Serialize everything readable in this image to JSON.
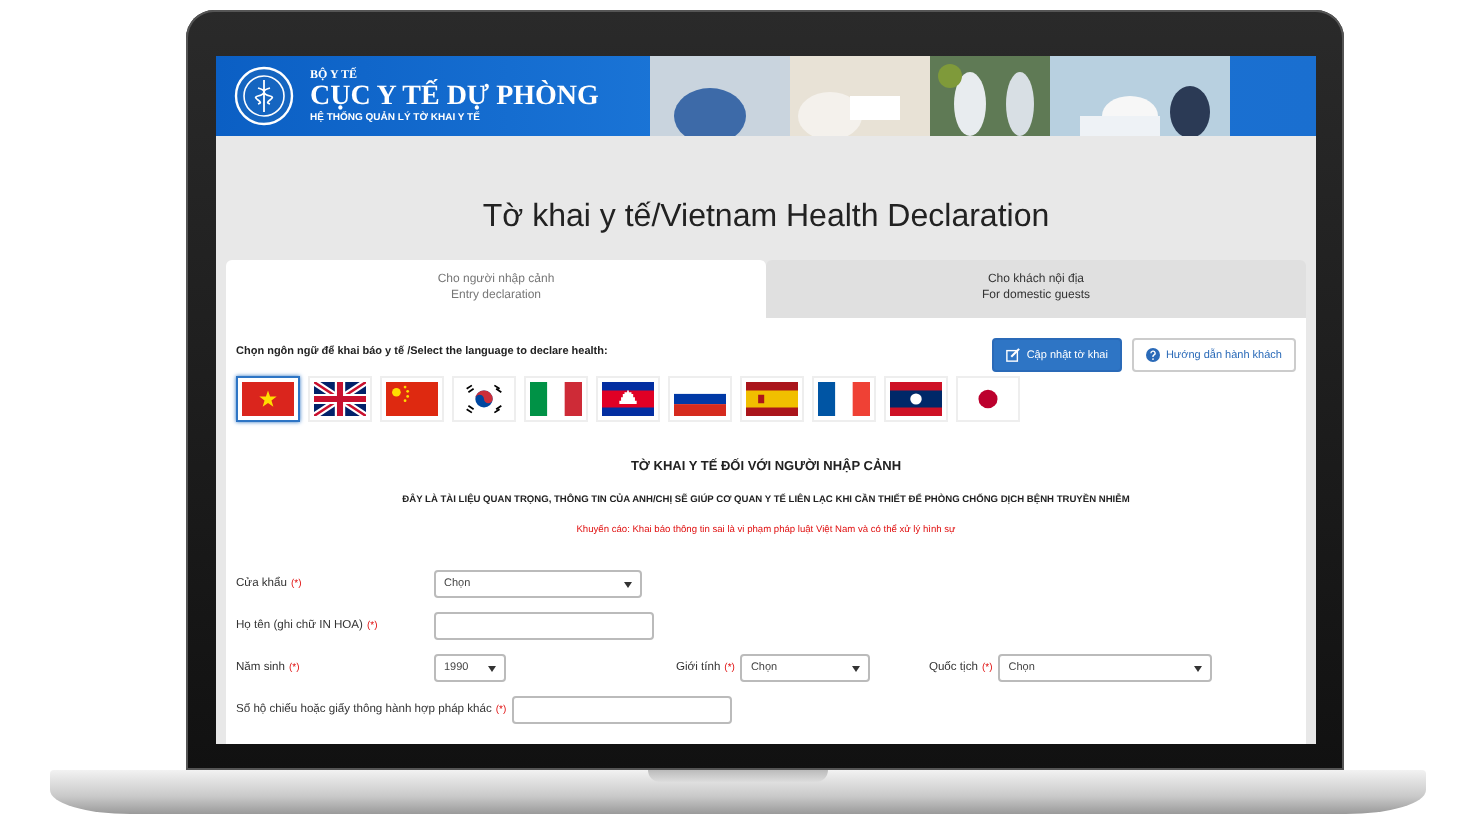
{
  "banner": {
    "ministry": "BỘ Y TẾ",
    "agency": "CỤC Y TẾ DỰ PHÒNG",
    "system": "HỆ THỐNG QUẢN LÝ TỜ KHAI Y TẾ"
  },
  "page_title": "Tờ khai y tế/Vietnam Health Declaration",
  "tabs": [
    {
      "label": "Cho người nhập cảnh",
      "sublabel": "Entry declaration",
      "selected": true
    },
    {
      "label": "Cho khách nội địa",
      "sublabel": "For domestic guests",
      "selected": false
    }
  ],
  "language_prompt": "Chọn ngôn ngữ để khai báo y tế /Select the language to declare health:",
  "buttons": [
    {
      "label": "Cập nhật tờ khai",
      "kind": "primary"
    },
    {
      "label": "Hướng dẫn hành khách",
      "kind": "help"
    }
  ],
  "languages": [
    {
      "kind": "vietnam",
      "selected": true
    },
    {
      "kind": "uk",
      "selected": false
    },
    {
      "kind": "china",
      "selected": false
    },
    {
      "kind": "korea",
      "selected": false
    },
    {
      "kind": "italy",
      "selected": false
    },
    {
      "kind": "cambodia",
      "selected": false
    },
    {
      "kind": "russia",
      "selected": false
    },
    {
      "kind": "spain",
      "selected": false
    },
    {
      "kind": "france",
      "selected": false
    },
    {
      "kind": "laos",
      "selected": false
    },
    {
      "kind": "japan",
      "selected": false
    }
  ],
  "form_title": "TỜ KHAI Y TẾ ĐỐI VỚI NGƯỜI NHẬP CẢNH",
  "notice": "ĐÂY LÀ TÀI LIỆU QUAN TRỌNG, THÔNG TIN CỦA ANH/CHỊ SẼ GIÚP CƠ QUAN Y TẾ LIÊN LẠC KHI CẦN THIẾT ĐỂ PHÒNG CHỐNG DỊCH BỆNH TRUYỀN NHIỄM",
  "warning": "Khuyến cáo: Khai báo thông tin sai là vi phạm pháp luật Việt Nam và có thể xử lý hình sự",
  "form_rows": [
    [
      {
        "label": "Cửa khẩu",
        "required": "(*)",
        "kind": "select",
        "value": "Chọn"
      }
    ],
    [
      {
        "label": "Họ tên (ghi chữ IN HOA)",
        "required": "(*)",
        "kind": "text"
      }
    ],
    [
      {
        "label": "Năm sinh",
        "required": "(*)",
        "kind": "select",
        "value": "1990"
      },
      {
        "label": "Giới tính",
        "required": "(*)",
        "kind": "select",
        "value": "Chọn"
      },
      {
        "label": "Quốc tịch",
        "required": "(*)",
        "kind": "select",
        "value": "Chọn"
      }
    ],
    [
      {
        "label": "Số hộ chiếu hoặc giấy thông hành hợp pháp khác",
        "required": "(*)",
        "kind": "text"
      }
    ]
  ]
}
